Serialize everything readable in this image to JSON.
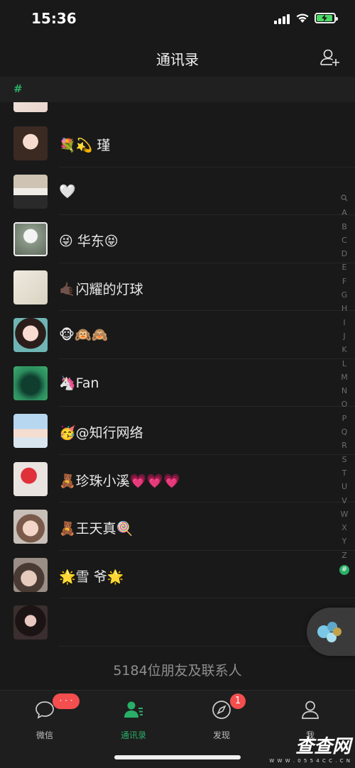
{
  "status_bar": {
    "time": "15:36"
  },
  "nav": {
    "title": "通讯录"
  },
  "section": {
    "letter": "#"
  },
  "contacts": [
    {
      "name": "💐💫 瑾"
    },
    {
      "name": "🤍"
    },
    {
      "name": "😜 华东😝"
    },
    {
      "name": "🤙🏿闪耀的灯球"
    },
    {
      "name": "🐵🙉🙈"
    },
    {
      "name": "🦄Fan"
    },
    {
      "name": "🥳@知行网络"
    },
    {
      "name": "🧸珍珠小溪💗💗💗"
    },
    {
      "name": "🧸王天真🍭"
    },
    {
      "name": "🌟雪 爷🌟"
    },
    {
      "name": ""
    }
  ],
  "footer": {
    "count_text": "5184位朋友及联系人"
  },
  "index_letters": [
    "Q",
    "A",
    "B",
    "C",
    "D",
    "E",
    "F",
    "G",
    "H",
    "I",
    "J",
    "K",
    "L",
    "M",
    "N",
    "O",
    "P",
    "Q",
    "R",
    "S",
    "T",
    "U",
    "V",
    "W",
    "X",
    "Y",
    "Z",
    "#"
  ],
  "tabs": [
    {
      "label": "微信",
      "badge": "· · ·"
    },
    {
      "label": "通讯录"
    },
    {
      "label": "发现",
      "badge": "1"
    },
    {
      "label": "我"
    }
  ],
  "watermark": {
    "title": "查查网",
    "subtitle": "W W W . 0 5 5 4 C C . C N"
  },
  "colors": {
    "accent": "#2aae67",
    "badge": "#f44e4e",
    "background": "#191919"
  }
}
